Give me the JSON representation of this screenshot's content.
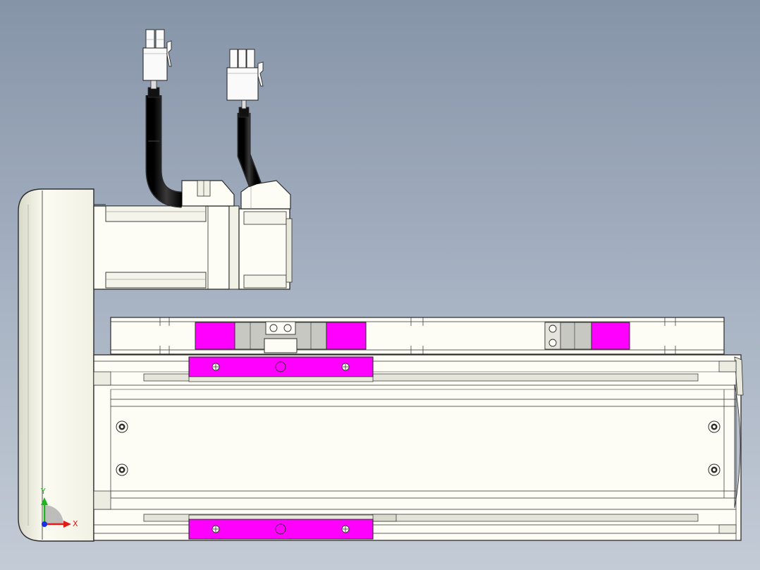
{
  "triad": {
    "x_label": "X",
    "y_label": "Y"
  },
  "colors": {
    "outline": "#2c2c2c",
    "body_fill": "#fdfdf6",
    "body_shade": "#e9e9dc",
    "magenta": "#ff00ff",
    "cable": "#111111",
    "clamp_gray": "#c8c8c2",
    "axis_x": "#e21a1a",
    "axis_y": "#1fb51f",
    "axis_z": "#1a2ee2"
  },
  "icons": {
    "triad": "coordinate-triad-icon",
    "screw": "screw-head-icon"
  }
}
